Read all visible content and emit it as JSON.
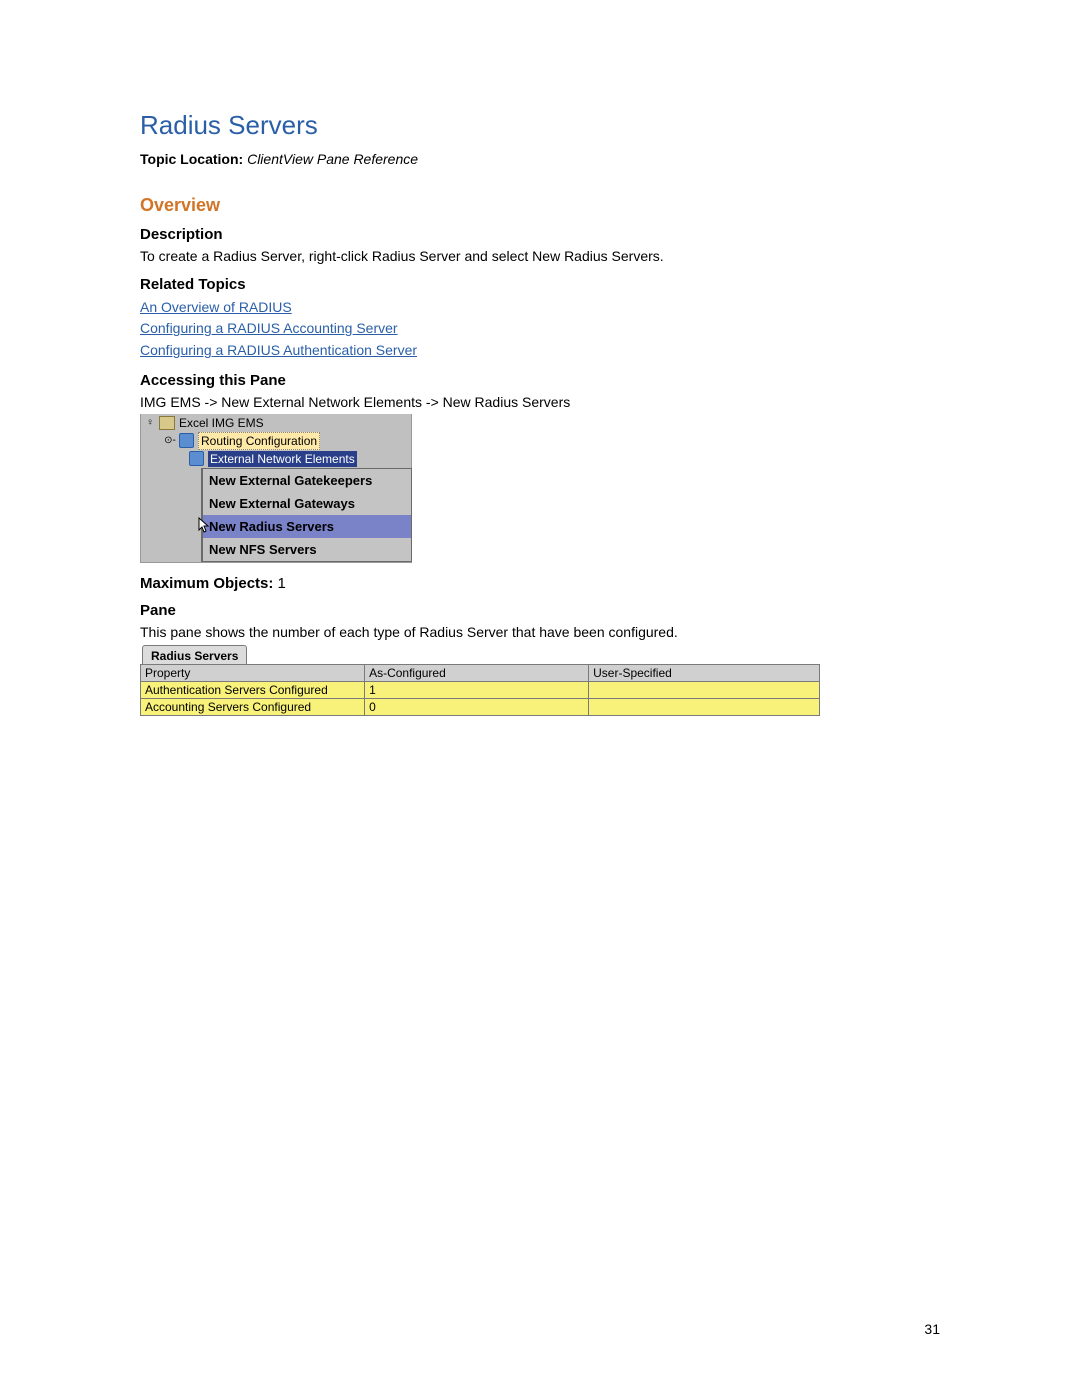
{
  "title": "Radius Servers",
  "topic_location_label": "Topic Location: ",
  "topic_location_value": "ClientView Pane Reference",
  "overview_heading": "Overview",
  "description_heading": "Description",
  "description_body": "To create a Radius Server, right-click Radius Server and select New Radius Servers.",
  "related_heading": "Related Topics",
  "related_links": {
    "link0": "An Overview of RADIUS",
    "link1": "Configuring a RADIUS Accounting Server",
    "link2": "Configuring a RADIUS Authentication Server"
  },
  "accessing_heading": "Accessing this Pane",
  "accessing_path": "IMG EMS -> New External Network Elements -> New Radius Servers",
  "tree": {
    "root": "Excel IMG EMS",
    "routing": "Routing Configuration",
    "external": "External Network Elements",
    "menu": {
      "item0": "New External Gatekeepers",
      "item1": "New External Gateways",
      "item2": "New Radius Servers",
      "item3": "New NFS Servers"
    }
  },
  "max_objects_label": "Maximum Objects: ",
  "max_objects_value": "1",
  "pane_heading": "Pane",
  "pane_body": "This pane shows the number of each type of Radius Server that have been configured.",
  "table": {
    "tab_label": "Radius Servers",
    "headers": {
      "h0": "Property",
      "h1": "As-Configured",
      "h2": "User-Specified"
    },
    "row0": {
      "prop": "Authentication Servers Configured",
      "as": "1",
      "user": ""
    },
    "row1": {
      "prop": "Accounting Servers Configured",
      "as": "0",
      "user": ""
    }
  },
  "page_number": "31"
}
